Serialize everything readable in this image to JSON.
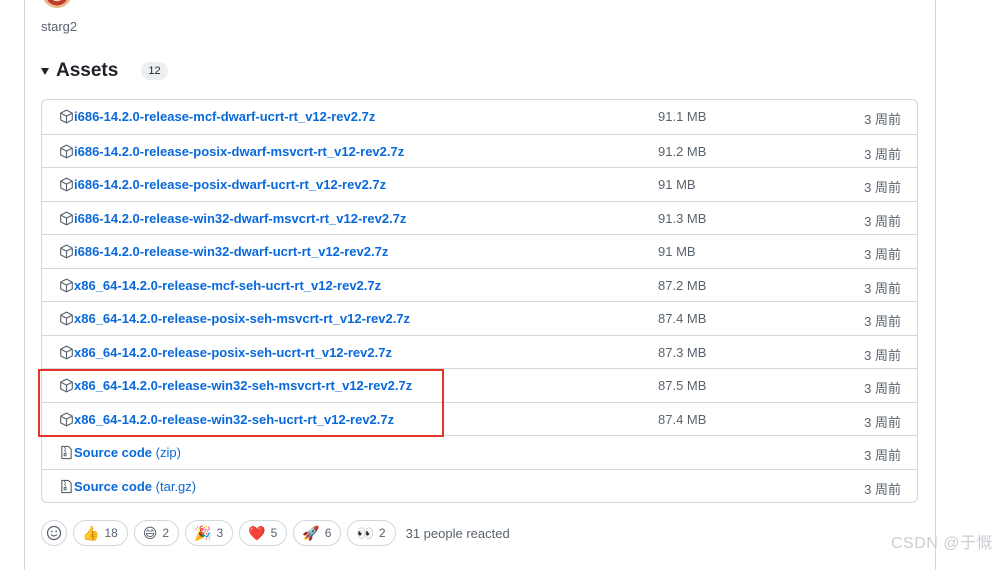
{
  "release": {
    "author": "starg2"
  },
  "assets": {
    "title": "Assets",
    "count": "12",
    "items": [
      {
        "name": "i686-14.2.0-release-mcf-dwarf-ucrt-rt_v12-rev2.7z",
        "size": "91.1 MB",
        "date": "3 周前",
        "icon": "package-icon"
      },
      {
        "name": "i686-14.2.0-release-posix-dwarf-msvcrt-rt_v12-rev2.7z",
        "size": "91.2 MB",
        "date": "3 周前",
        "icon": "package-icon"
      },
      {
        "name": "i686-14.2.0-release-posix-dwarf-ucrt-rt_v12-rev2.7z",
        "size": "91 MB",
        "date": "3 周前",
        "icon": "package-icon"
      },
      {
        "name": "i686-14.2.0-release-win32-dwarf-msvcrt-rt_v12-rev2.7z",
        "size": "91.3 MB",
        "date": "3 周前",
        "icon": "package-icon"
      },
      {
        "name": "i686-14.2.0-release-win32-dwarf-ucrt-rt_v12-rev2.7z",
        "size": "91 MB",
        "date": "3 周前",
        "icon": "package-icon"
      },
      {
        "name": "x86_64-14.2.0-release-mcf-seh-ucrt-rt_v12-rev2.7z",
        "size": "87.2 MB",
        "date": "3 周前",
        "icon": "package-icon"
      },
      {
        "name": "x86_64-14.2.0-release-posix-seh-msvcrt-rt_v12-rev2.7z",
        "size": "87.4 MB",
        "date": "3 周前",
        "icon": "package-icon"
      },
      {
        "name": "x86_64-14.2.0-release-posix-seh-ucrt-rt_v12-rev2.7z",
        "size": "87.3 MB",
        "date": "3 周前",
        "icon": "package-icon"
      },
      {
        "name": "x86_64-14.2.0-release-win32-seh-msvcrt-rt_v12-rev2.7z",
        "size": "87.5 MB",
        "date": "3 周前",
        "icon": "package-icon"
      },
      {
        "name": "x86_64-14.2.0-release-win32-seh-ucrt-rt_v12-rev2.7z",
        "size": "87.4 MB",
        "date": "3 周前",
        "icon": "package-icon"
      },
      {
        "name": "Source code",
        "suffix": "(zip)",
        "size": "",
        "date": "3 周前",
        "icon": "file-zip-icon"
      },
      {
        "name": "Source code",
        "suffix": "(tar.gz)",
        "size": "",
        "date": "3 周前",
        "icon": "file-zip-icon"
      }
    ]
  },
  "reactions": {
    "items": [
      {
        "emoji": "👍",
        "icon": "thumbs-up-icon",
        "count": "18"
      },
      {
        "emoji": "😄",
        "icon": "laugh-icon",
        "count": "2"
      },
      {
        "emoji": "🎉",
        "icon": "hooray-icon",
        "count": "3"
      },
      {
        "emoji": "❤️",
        "icon": "heart-icon",
        "count": "5"
      },
      {
        "emoji": "🚀",
        "icon": "rocket-icon",
        "count": "6"
      },
      {
        "emoji": "👀",
        "icon": "eyes-icon",
        "count": "2"
      }
    ],
    "summary": "31 people reacted"
  },
  "watermark": "CSDN @于慨",
  "colors": {
    "link": "#0969da",
    "border": "#d0d7de",
    "muted": "#59636e",
    "highlight": "#e5332a"
  }
}
